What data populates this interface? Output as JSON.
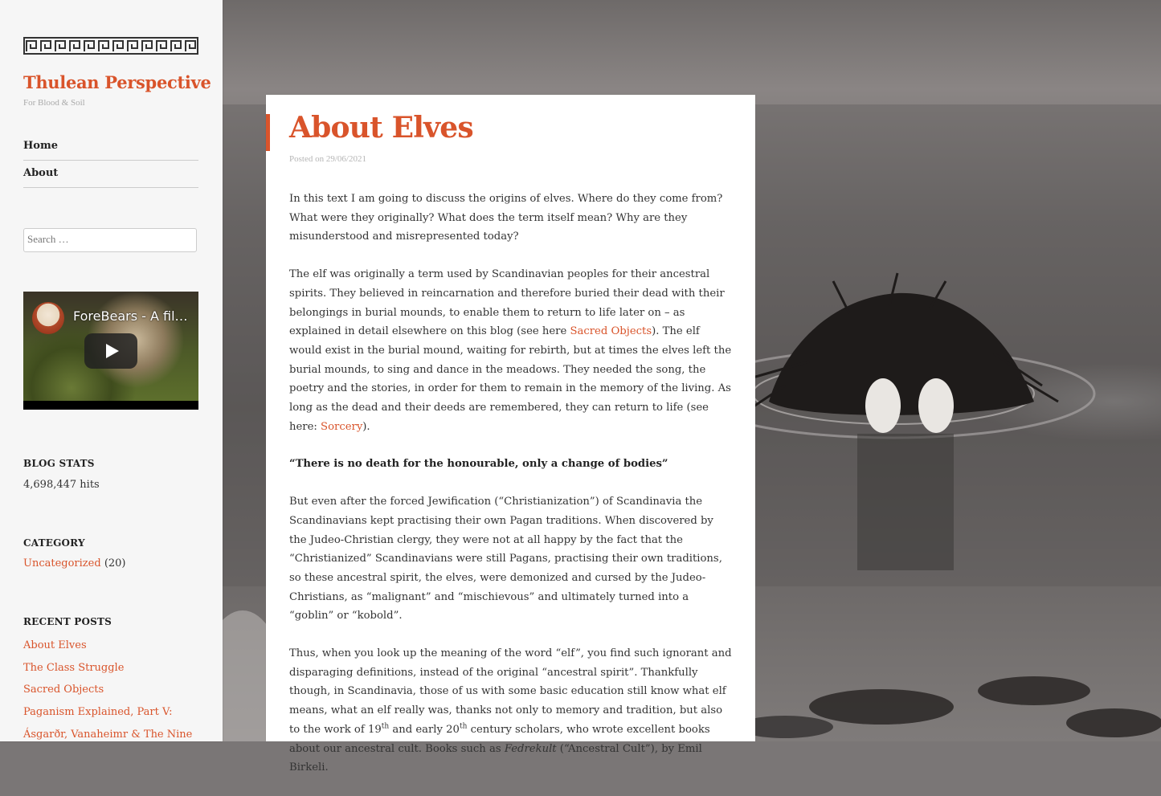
{
  "site": {
    "title": "Thulean Perspective",
    "tagline": "For Blood & Soil"
  },
  "nav": [
    {
      "label": "Home"
    },
    {
      "label": "About"
    }
  ],
  "search": {
    "placeholder": "Search …"
  },
  "video": {
    "title": "ForeBears - A fil…"
  },
  "blog_stats": {
    "heading": "BLOG STATS",
    "hits": "4,698,447 hits"
  },
  "category": {
    "heading": "CATEGORY",
    "name": "Uncategorized",
    "count": "(20)"
  },
  "recent_posts": {
    "heading": "RECENT POSTS",
    "items": [
      "About Elves",
      "The Class Struggle",
      "Sacred Objects",
      "Paganism Explained, Part V:",
      "Ásgarðr, Vanaheimr & The Nine"
    ]
  },
  "article": {
    "title": "About Elves",
    "date": "Posted on 29/06/2021",
    "p1": "In this text I am going to discuss the origins of elves. Where do they come from? What were they originally? What does the term itself mean? Why are they misunderstood and misrepresented today?",
    "p2_a": "The elf was originally a term used by Scandinavian peoples for their ancestral spirits. They believed in reincarnation and therefore buried their dead with their belongings in burial mounds, to enable them to return to life later on – as explained in detail elsewhere on this blog (see here ",
    "p2_link1": "Sacred Objects",
    "p2_b": "). The elf would exist in the burial mound, waiting for rebirth, but at times the elves left the burial mounds, to sing and dance in the meadows. They needed the song, the poetry and the stories, in order for them to remain in the memory of the living. As long as the dead and their deeds are remembered, they can return to life (see here: ",
    "p2_link2": "Sorcery",
    "p2_c": ").",
    "quote": "“There is no death for the honourable, only a change of bodies”",
    "p3": "But even after the forced Jewification (“Christianization”) of Scandinavia the Scandinavians kept practising their own Pagan traditions. When discovered by the Judeo-Christian clergy, they were not at all happy by the fact that the “Christianized” Scandinavians were still Pagans, practising their own traditions, so these ancestral spirit, the elves, were demonized and cursed by the Judeo-Christians, as “malignant” and “mischievous” and ultimately turned into a “goblin” or “kobold”.",
    "p4_a": "Thus, when you look up the meaning of the word “elf”, you find such ignorant and disparaging definitions, instead of the original “ancestral spirit”. Thankfully though, in Scandinavia, those of us with some basic education still know what elf means, what an elf really was, thanks not only to memory and tradition, but also to the work of 19",
    "p4_sup1": "th",
    "p4_b": " and early 20",
    "p4_sup2": "th",
    "p4_c": " century scholars, who wrote excellent books about our ancestral cult. Books such as ",
    "p4_em": "Fedrekult",
    "p4_d": " (“Ancestral Cult”), by Emil Birkeli."
  },
  "colors": {
    "accent": "#d9542b",
    "sidebar_bg": "#f6f6f6"
  }
}
